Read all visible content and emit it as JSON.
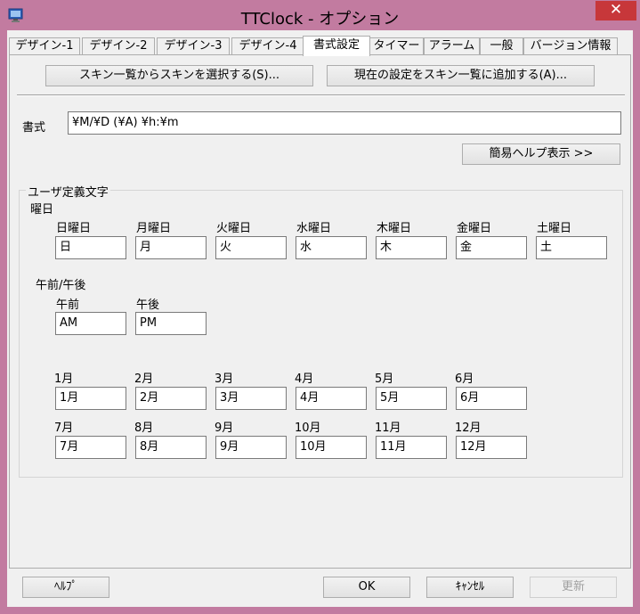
{
  "window": {
    "title": "TTClock - オプション",
    "close_glyph": "✕"
  },
  "tabs": [
    "デザイン-1",
    "デザイン-2",
    "デザイン-3",
    "デザイン-4",
    "書式設定",
    "タイマー",
    "アラーム",
    "一般",
    "バージョン情報"
  ],
  "skin": {
    "select_label": "スキン一覧からスキンを選択する(S)...",
    "add_label": "現在の設定をスキン一覧に追加する(A)..."
  },
  "format": {
    "label": "書式",
    "value": "¥M/¥D (¥A) ¥h:¥m",
    "help_label": "簡易ヘルプ表示 >>"
  },
  "user_defined": {
    "title": "ユーザ定義文字",
    "weekday_title": "曜日",
    "weekdays": [
      {
        "label": "日曜日",
        "value": "日"
      },
      {
        "label": "月曜日",
        "value": "月"
      },
      {
        "label": "火曜日",
        "value": "火"
      },
      {
        "label": "水曜日",
        "value": "水"
      },
      {
        "label": "木曜日",
        "value": "木"
      },
      {
        "label": "金曜日",
        "value": "金"
      },
      {
        "label": "土曜日",
        "value": "土"
      }
    ],
    "ampm_title": "午前/午後",
    "ampm": [
      {
        "label": "午前",
        "value": "AM"
      },
      {
        "label": "午後",
        "value": "PM"
      }
    ],
    "months": [
      {
        "label": "1月",
        "value": "1月"
      },
      {
        "label": "2月",
        "value": "2月"
      },
      {
        "label": "3月",
        "value": "3月"
      },
      {
        "label": "4月",
        "value": "4月"
      },
      {
        "label": "5月",
        "value": "5月"
      },
      {
        "label": "6月",
        "value": "6月"
      },
      {
        "label": "7月",
        "value": "7月"
      },
      {
        "label": "8月",
        "value": "8月"
      },
      {
        "label": "9月",
        "value": "9月"
      },
      {
        "label": "10月",
        "value": "10月"
      },
      {
        "label": "11月",
        "value": "11月"
      },
      {
        "label": "12月",
        "value": "12月"
      }
    ]
  },
  "footer": {
    "help": "ﾍﾙﾌﾟ",
    "ok": "OK",
    "cancel": "ｷｬﾝｾﾙ",
    "apply": "更新"
  },
  "colors": {
    "frame": "#c27ba0",
    "close": "#c7373a",
    "face": "#f0f0f0"
  },
  "icons": {
    "app": "clock-window-icon",
    "close": "close-icon"
  }
}
